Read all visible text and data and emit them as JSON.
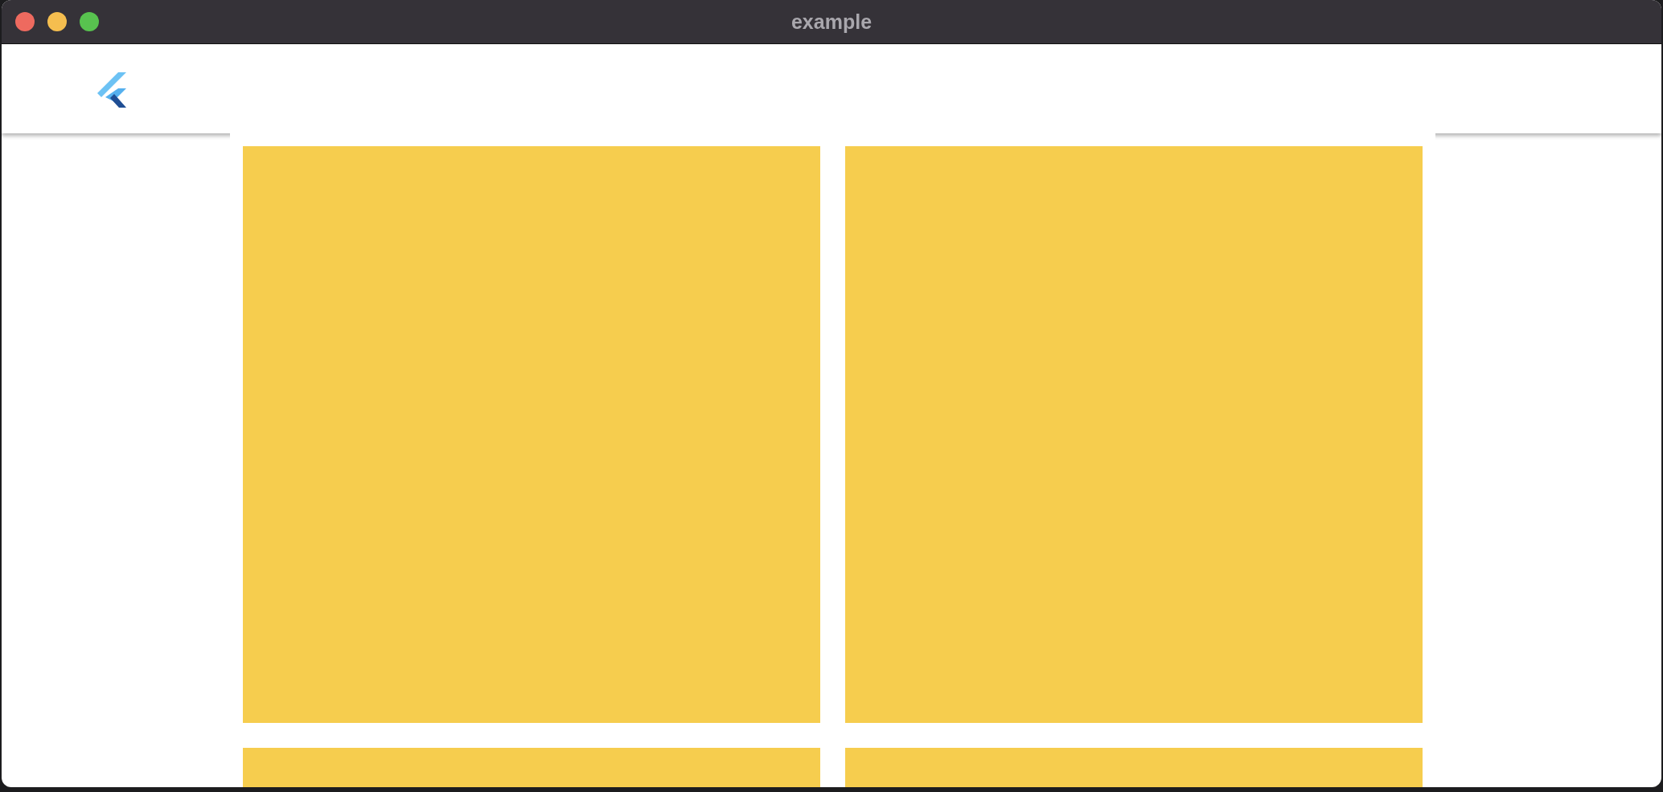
{
  "window": {
    "title": "example"
  },
  "tiles": [
    {
      "color": "#f6cd4e"
    },
    {
      "color": "#f6cd4e"
    },
    {
      "color": "#f6cd4e"
    },
    {
      "color": "#f6cd4e"
    }
  ]
}
